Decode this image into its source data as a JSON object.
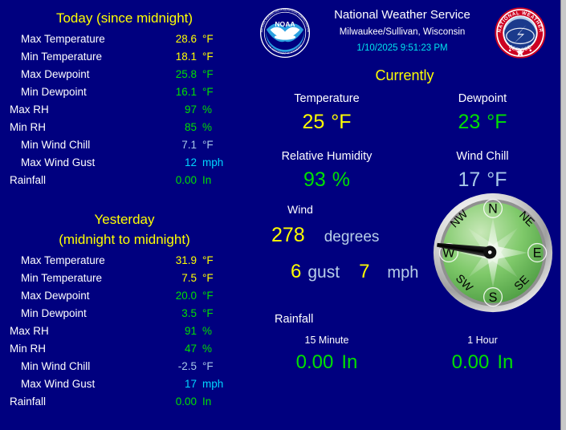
{
  "colors": {
    "background": "#00007f",
    "heading_yellow": "#ffff00",
    "label_white": "#ffffff",
    "temp_yellow": "#ffff00",
    "green": "#00e000",
    "wind_chill_blue": "#a8c8e8",
    "cyan": "#00e5ee",
    "scrollbar": "#c8c8c8"
  },
  "header": {
    "noaa_logo_icon": "noaa-seal-icon",
    "nws_logo_icon": "nws-seal-icon",
    "title": "National Weather Service",
    "subtitle": "Milwaukee/Sullivan, Wisconsin",
    "timestamp": "1/10/2025 9:51:23 PM",
    "currently_title": "Currently"
  },
  "today": {
    "title": "Today (since midnight)",
    "rows": [
      {
        "label": "Max Temperature",
        "value": "28.6",
        "unit": "°F",
        "color": "#ffff00",
        "indent": 1
      },
      {
        "label": "Min Temperature",
        "value": "18.1",
        "unit": "°F",
        "color": "#ffff00",
        "indent": 1
      },
      {
        "label": "Max Dewpoint",
        "value": "25.8",
        "unit": "°F",
        "color": "#00e000",
        "indent": 1
      },
      {
        "label": "Min Dewpoint",
        "value": "16.1",
        "unit": "°F",
        "color": "#00e000",
        "indent": 1
      },
      {
        "label": "Max RH",
        "value": "97",
        "unit": "%",
        "color": "#00e000",
        "indent": 0
      },
      {
        "label": "Min RH",
        "value": "85",
        "unit": "%",
        "color": "#00e000",
        "indent": 0
      },
      {
        "label": "Min Wind Chill",
        "value": "7.1",
        "unit": "°F",
        "color": "#a8c8e8",
        "indent": 1
      },
      {
        "label": "Max Wind Gust",
        "value": "12",
        "unit": "mph",
        "color": "#00d7ff",
        "indent": 1
      },
      {
        "label": "Rainfall",
        "value": "0.00",
        "unit": "In",
        "color": "#00e000",
        "indent": 0
      }
    ]
  },
  "yesterday": {
    "title_line1": "Yesterday",
    "title_line2": "(midnight to midnight)",
    "rows": [
      {
        "label": "Max Temperature",
        "value": "31.9",
        "unit": "°F",
        "color": "#ffff00",
        "indent": 1
      },
      {
        "label": "Min Temperature",
        "value": "7.5",
        "unit": "°F",
        "color": "#ffff00",
        "indent": 1
      },
      {
        "label": "Max Dewpoint",
        "value": "20.0",
        "unit": "°F",
        "color": "#00e000",
        "indent": 1
      },
      {
        "label": "Min Dewpoint",
        "value": "3.5",
        "unit": "°F",
        "color": "#00e000",
        "indent": 1
      },
      {
        "label": "Max RH",
        "value": "91",
        "unit": "%",
        "color": "#00e000",
        "indent": 0
      },
      {
        "label": "Min RH",
        "value": "47",
        "unit": "%",
        "color": "#00e000",
        "indent": 0
      },
      {
        "label": "Min Wind Chill",
        "value": "-2.5",
        "unit": "°F",
        "color": "#a8c8e8",
        "indent": 1
      },
      {
        "label": "Max Wind Gust",
        "value": "17",
        "unit": "mph",
        "color": "#00d7ff",
        "indent": 1
      },
      {
        "label": "Rainfall",
        "value": "0.00",
        "unit": "In",
        "color": "#00e000",
        "indent": 0
      }
    ]
  },
  "currently": {
    "cells": [
      {
        "label": "Temperature",
        "value": "25",
        "unit": "°F",
        "color": "#ffff00"
      },
      {
        "label": "Dewpoint",
        "value": "23",
        "unit": "°F",
        "color": "#00e000"
      },
      {
        "label": "Relative Humidity",
        "value": "93",
        "unit": "%",
        "color": "#00e000"
      },
      {
        "label": "Wind Chill",
        "value": "17",
        "unit": "°F",
        "color": "#a8c8e8"
      }
    ]
  },
  "wind": {
    "heading": "Wind",
    "direction": "278",
    "direction_unit": "degrees",
    "speed": "6",
    "gust_label": "gust",
    "gust": "7",
    "speed_unit": "mph",
    "compass": {
      "icon": "compass-dial-icon",
      "needle_degrees": 278,
      "points": [
        "N",
        "NE",
        "E",
        "SE",
        "S",
        "SW",
        "NW"
      ]
    }
  },
  "rainfall": {
    "heading": "Rainfall",
    "cells": [
      {
        "label": "15 Minute",
        "value": "0.00",
        "unit": "In"
      },
      {
        "label": "1 Hour",
        "value": "0.00",
        "unit": "In"
      }
    ]
  }
}
